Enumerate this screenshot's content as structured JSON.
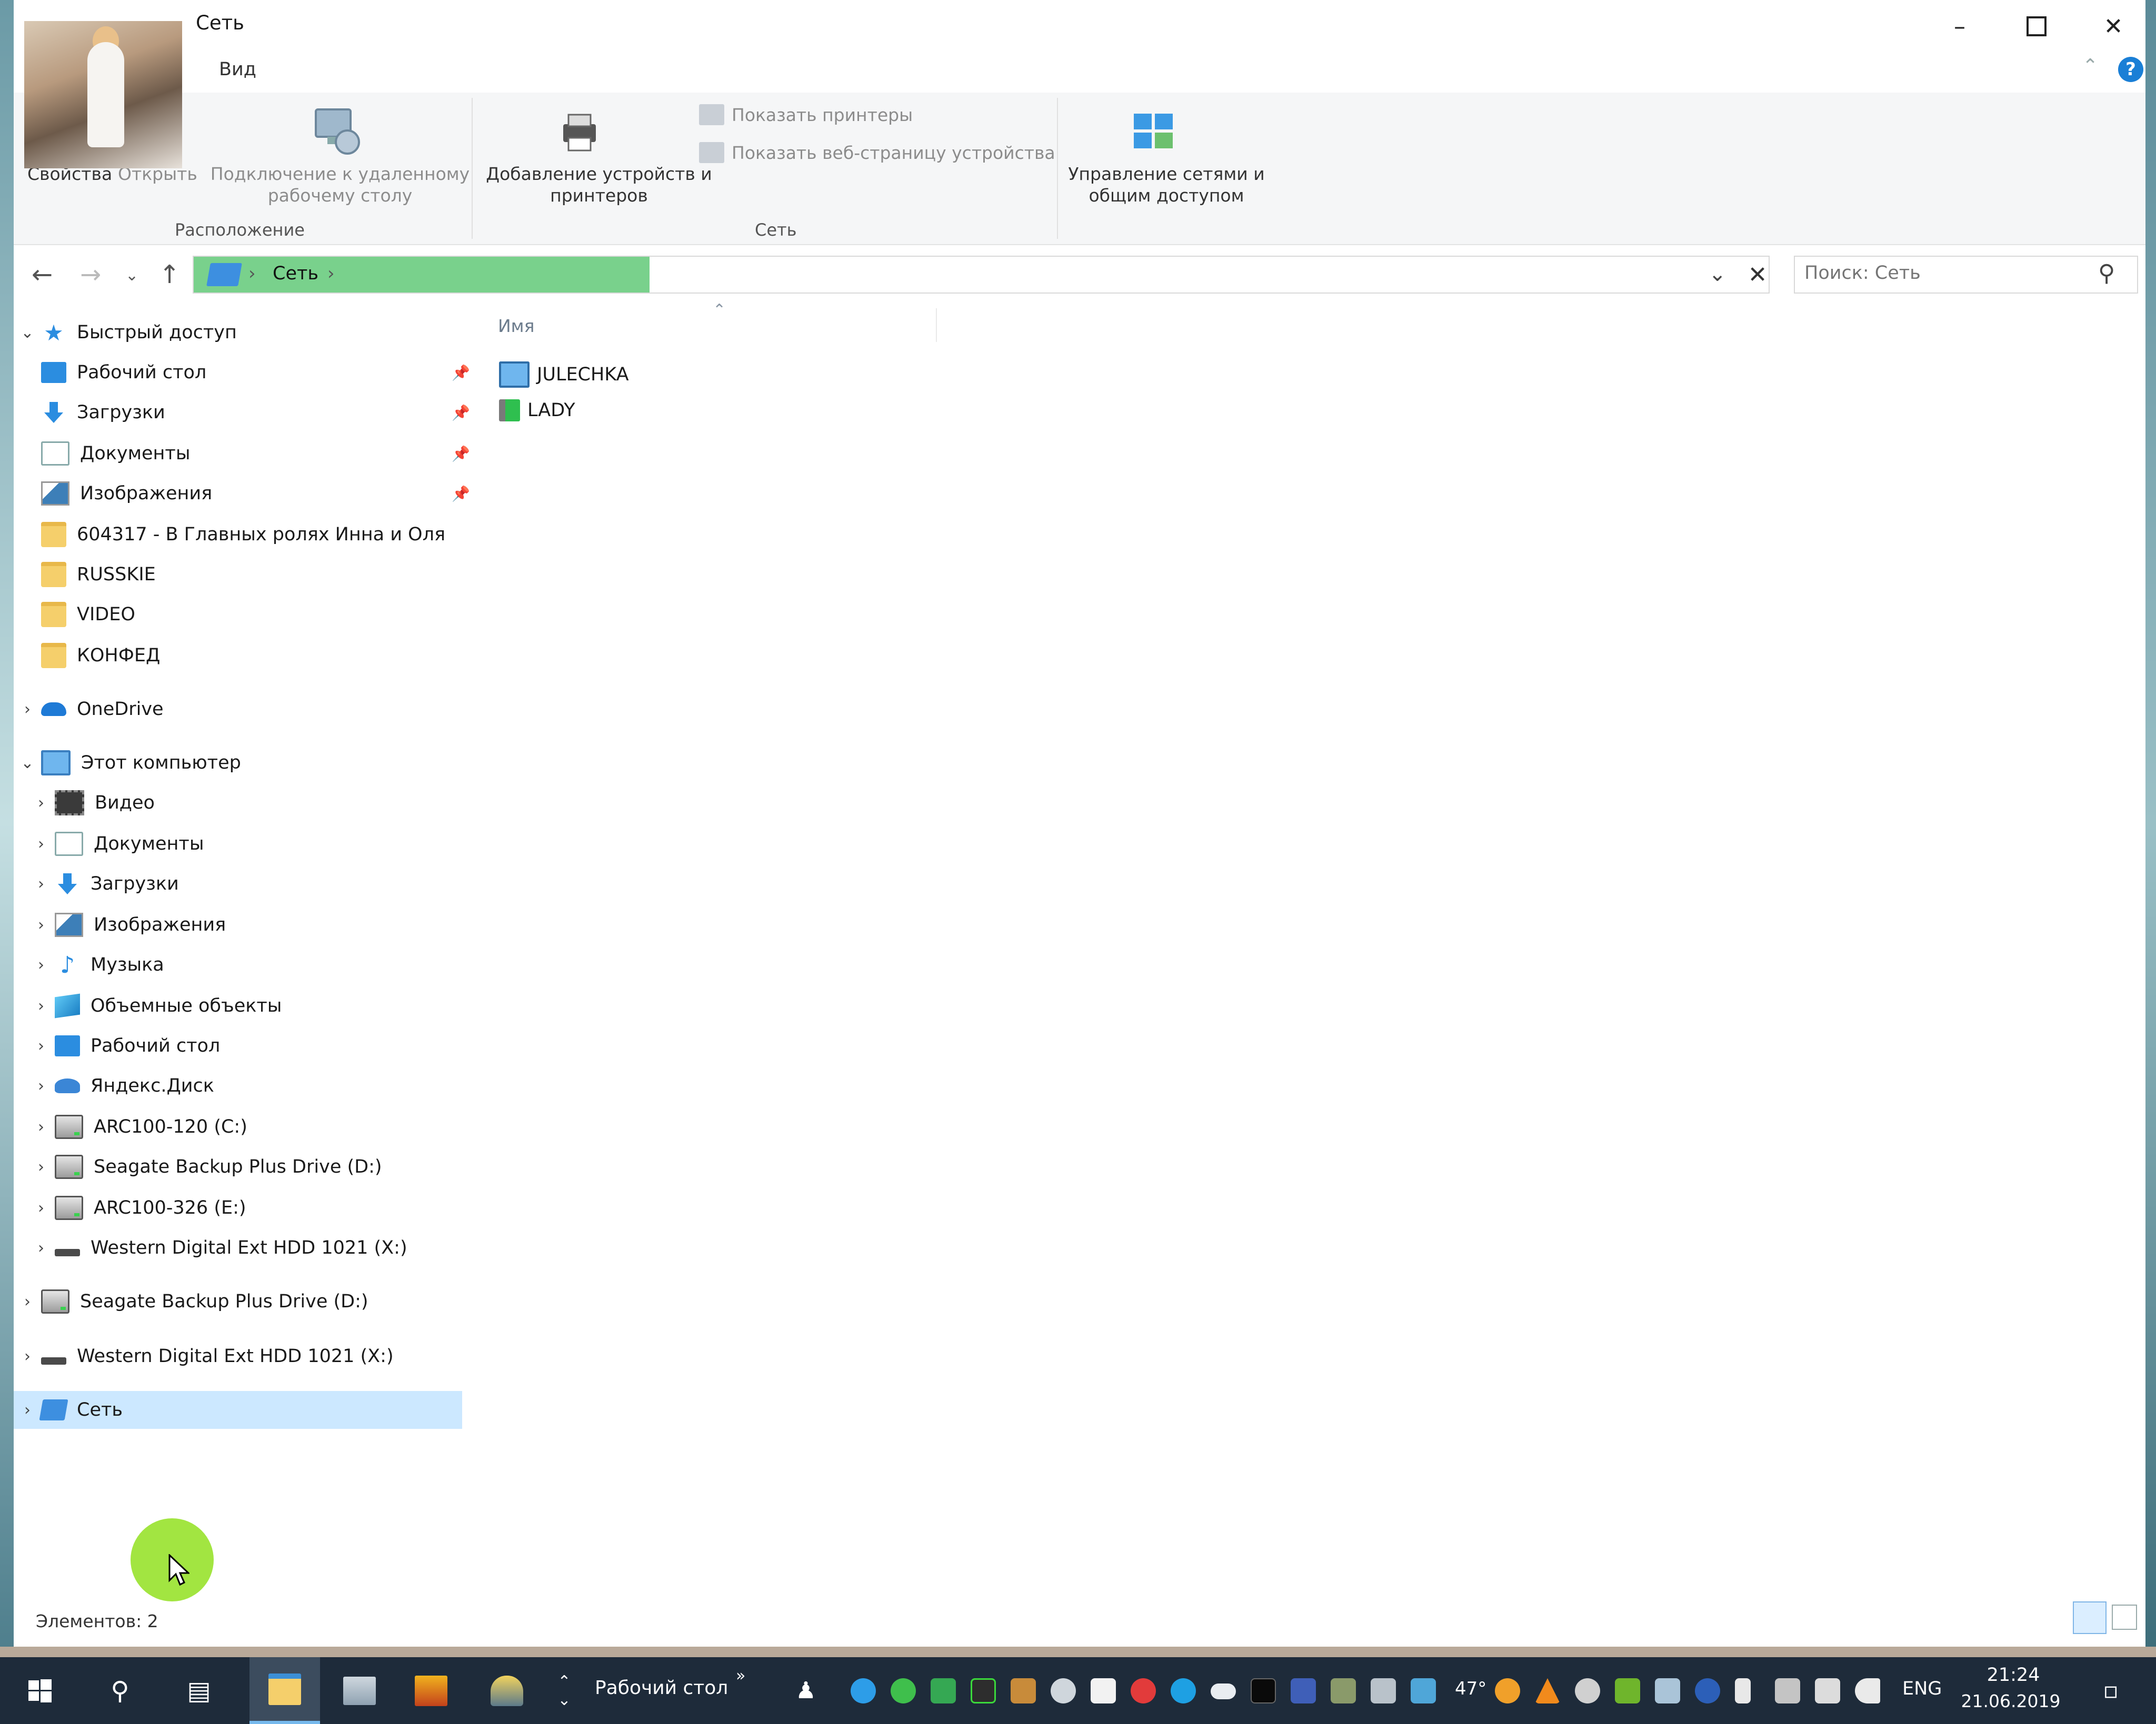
{
  "window": {
    "title": "Сеть",
    "tabs": {
      "view": "Вид"
    }
  },
  "ribbon": {
    "location_group": {
      "label": "Расположение",
      "properties": "Свойства",
      "open": "Открыть",
      "remote_desktop": "Подключение к удаленному рабочему столу"
    },
    "network_group": {
      "label": "Сеть",
      "add_devices": "Добавление устройств и принтеров",
      "show_printers": "Показать принтеры",
      "show_device_page": "Показать веб-страницу устройства"
    },
    "network_center": "Управление сетями и общим доступом"
  },
  "address": {
    "crumb": "Сеть",
    "search_placeholder": "Поиск: Сеть"
  },
  "nav": {
    "quick_access": "Быстрый доступ",
    "quick_items": [
      "Рабочий стол",
      "Загрузки",
      "Документы",
      "Изображения",
      "604317 - В Главных ролях Инна и Оля",
      "RUSSKIE",
      "VIDEO",
      "КОНФЕД"
    ],
    "onedrive": "OneDrive",
    "this_pc": "Этот компьютер",
    "pc_items": [
      "Видео",
      "Документы",
      "Загрузки",
      "Изображения",
      "Музыка",
      "Объемные объекты",
      "Рабочий стол",
      "Яндекс.Диск",
      "ARC100-120 (C:)",
      "Seagate Backup Plus Drive (D:)",
      "ARC100-326 (E:)",
      "Western Digital Ext HDD 1021 (X:)"
    ],
    "seagate": "Seagate Backup Plus Drive (D:)",
    "wd": "Western Digital Ext HDD 1021 (X:)",
    "network": "Сеть"
  },
  "content": {
    "column_name": "Имя",
    "items": [
      "JULECHKA",
      "LADY"
    ]
  },
  "status": {
    "count": "Элементов: 2"
  },
  "taskbar": {
    "desktop_label": "Рабочий стол",
    "temperature": "47°",
    "lang": "ENG",
    "time": "21:24",
    "date": "21.06.2019"
  }
}
